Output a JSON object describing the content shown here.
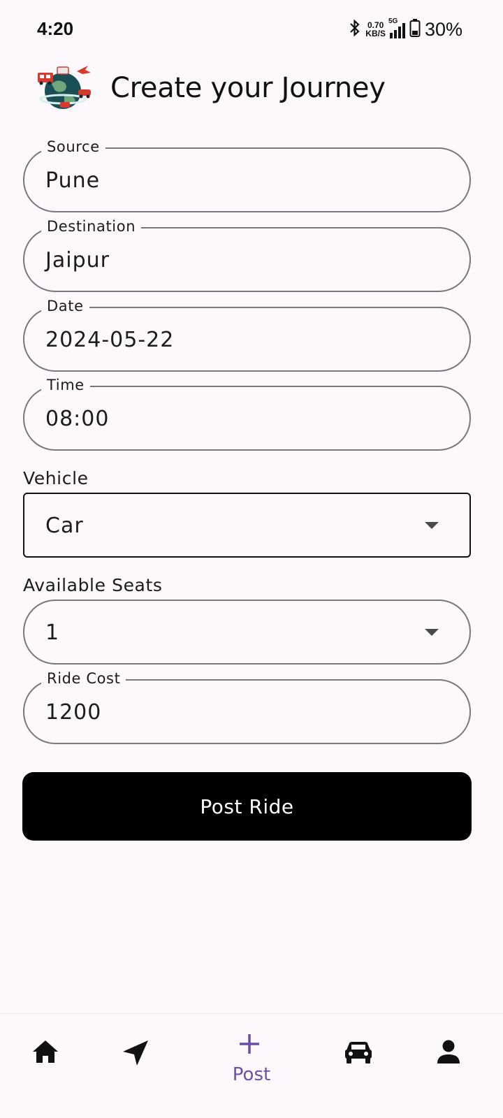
{
  "status_bar": {
    "time": "4:20",
    "net_speed_value": "0.70",
    "net_speed_unit": "KB/S",
    "network_type": "5G",
    "battery_percent": "30%"
  },
  "header": {
    "title": "Create your Journey"
  },
  "form": {
    "source": {
      "label": "Source",
      "value": "Pune"
    },
    "destination": {
      "label": "Destination",
      "value": "Jaipur"
    },
    "date": {
      "label": "Date",
      "value": "2024-05-22"
    },
    "time": {
      "label": "Time",
      "value": "08:00"
    },
    "vehicle": {
      "label": "Vehicle",
      "value": "Car"
    },
    "seats": {
      "label": "Available Seats",
      "value": "1"
    },
    "cost": {
      "label": "Ride Cost",
      "value": "1200"
    },
    "submit_label": "Post Ride"
  },
  "bottom_nav": {
    "items": [
      {
        "icon": "home-icon"
      },
      {
        "icon": "navigation-icon"
      },
      {
        "icon": "add-icon",
        "label": "Post",
        "active": true
      },
      {
        "icon": "car-icon"
      },
      {
        "icon": "person-icon"
      }
    ],
    "active_color": "#6b4fa8"
  }
}
